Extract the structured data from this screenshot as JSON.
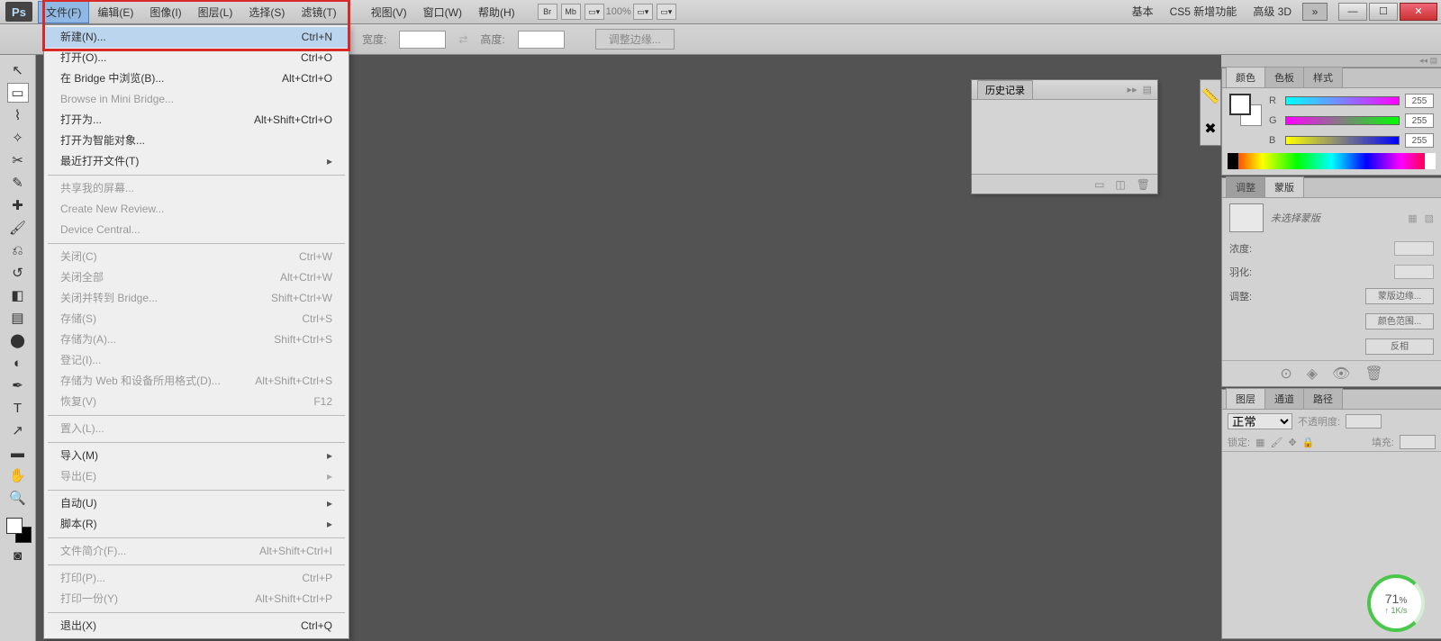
{
  "app_logo": "Ps",
  "menubar": {
    "items": [
      "文件(F)",
      "编辑(E)",
      "图像(I)",
      "图层(L)",
      "选择(S)",
      "滤镜(T)",
      "视图(V)",
      "窗口(W)",
      "帮助(H)"
    ],
    "right": {
      "basic": "基本",
      "cs5": "CS5 新增功能",
      "adv3d": "高级 3D"
    },
    "zoom": "100%"
  },
  "options": {
    "width_label": "宽度:",
    "height_label": "高度:",
    "refine": "调整边缘..."
  },
  "file_menu": [
    {
      "label": "新建(N)...",
      "shortcut": "Ctrl+N",
      "hl": true
    },
    {
      "label": "打开(O)...",
      "shortcut": "Ctrl+O"
    },
    {
      "label": "在 Bridge 中浏览(B)...",
      "shortcut": "Alt+Ctrl+O"
    },
    {
      "label": "Browse in Mini Bridge...",
      "shortcut": "",
      "dis": true
    },
    {
      "label": "打开为...",
      "shortcut": "Alt+Shift+Ctrl+O"
    },
    {
      "label": "打开为智能对象...",
      "shortcut": ""
    },
    {
      "label": "最近打开文件(T)",
      "shortcut": "",
      "sub": true
    },
    {
      "sep": true
    },
    {
      "label": "共享我的屏幕...",
      "shortcut": "",
      "dis": true
    },
    {
      "label": "Create New Review...",
      "shortcut": "",
      "dis": true
    },
    {
      "label": "Device Central...",
      "shortcut": "",
      "dis": true
    },
    {
      "sep": true
    },
    {
      "label": "关闭(C)",
      "shortcut": "Ctrl+W",
      "dis": true
    },
    {
      "label": "关闭全部",
      "shortcut": "Alt+Ctrl+W",
      "dis": true
    },
    {
      "label": "关闭并转到 Bridge...",
      "shortcut": "Shift+Ctrl+W",
      "dis": true
    },
    {
      "label": "存储(S)",
      "shortcut": "Ctrl+S",
      "dis": true
    },
    {
      "label": "存储为(A)...",
      "shortcut": "Shift+Ctrl+S",
      "dis": true
    },
    {
      "label": "登记(I)...",
      "shortcut": "",
      "dis": true
    },
    {
      "label": "存储为 Web 和设备所用格式(D)...",
      "shortcut": "Alt+Shift+Ctrl+S",
      "dis": true
    },
    {
      "label": "恢复(V)",
      "shortcut": "F12",
      "dis": true
    },
    {
      "sep": true
    },
    {
      "label": "置入(L)...",
      "shortcut": "",
      "dis": true
    },
    {
      "sep": true
    },
    {
      "label": "导入(M)",
      "shortcut": "",
      "sub": true
    },
    {
      "label": "导出(E)",
      "shortcut": "",
      "sub": true,
      "dis": true
    },
    {
      "sep": true
    },
    {
      "label": "自动(U)",
      "shortcut": "",
      "sub": true
    },
    {
      "label": "脚本(R)",
      "shortcut": "",
      "sub": true
    },
    {
      "sep": true
    },
    {
      "label": "文件简介(F)...",
      "shortcut": "Alt+Shift+Ctrl+I",
      "dis": true
    },
    {
      "sep": true
    },
    {
      "label": "打印(P)...",
      "shortcut": "Ctrl+P",
      "dis": true
    },
    {
      "label": "打印一份(Y)",
      "shortcut": "Alt+Shift+Ctrl+P",
      "dis": true
    },
    {
      "sep": true
    },
    {
      "label": "退出(X)",
      "shortcut": "Ctrl+Q"
    }
  ],
  "history_panel": {
    "title": "历史记录"
  },
  "color_panel": {
    "tabs": [
      "颜色",
      "色板",
      "样式"
    ],
    "r_label": "R",
    "g_label": "G",
    "b_label": "B",
    "r": "255",
    "g": "255",
    "b": "255"
  },
  "mask_panel": {
    "tabs": [
      "调整",
      "蒙版"
    ],
    "placeholder": "未选择蒙版",
    "density": "浓度:",
    "feather": "羽化:",
    "refine": "调整:",
    "btn_edge": "蒙版边缘...",
    "btn_colorrange": "颜色范围...",
    "btn_invert": "反相"
  },
  "layers_panel": {
    "tabs": [
      "图层",
      "通道",
      "路径"
    ],
    "blend": "正常",
    "opacity_label": "不透明度:",
    "lock_label": "锁定:",
    "fill_label": "填充:"
  },
  "speed": {
    "pct": "71",
    "unit": "%",
    "rate": "1K/s"
  }
}
